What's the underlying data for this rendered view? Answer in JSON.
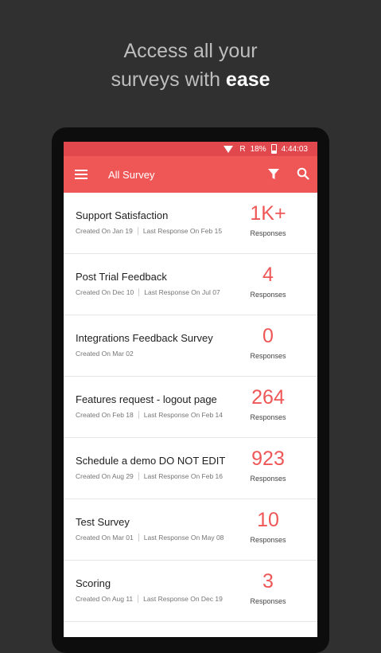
{
  "promo": {
    "line1": "Access all your",
    "line2_prefix": "surveys with ",
    "line2_bold": "ease"
  },
  "status_bar": {
    "network": "R",
    "battery": "18%",
    "time": "4:44:03"
  },
  "toolbar": {
    "title": "All Survey"
  },
  "surveys": [
    {
      "title": "Support Satisfaction",
      "created": "Created On Jan 19",
      "last_response": "Last Response On Feb 15",
      "count": "1K+",
      "count_label": "Responses"
    },
    {
      "title": "Post Trial Feedback",
      "created": "Created On Dec 10",
      "last_response": "Last Response On Jul 07",
      "count": "4",
      "count_label": "Responses"
    },
    {
      "title": "Integrations Feedback Survey",
      "created": "Created On Mar 02",
      "last_response": "",
      "count": "0",
      "count_label": "Responses"
    },
    {
      "title": "Features request - logout page",
      "created": "Created On Feb 18",
      "last_response": "Last Response On Feb 14",
      "count": "264",
      "count_label": "Responses"
    },
    {
      "title": "Schedule a demo DO NOT EDIT",
      "created": "Created On Aug 29",
      "last_response": "Last Response On Feb 16",
      "count": "923",
      "count_label": "Responses"
    },
    {
      "title": "Test Survey",
      "created": "Created On Mar 01",
      "last_response": "Last Response On May 08",
      "count": "10",
      "count_label": "Responses"
    },
    {
      "title": "Scoring",
      "created": "Created On Aug 11",
      "last_response": "Last Response On Dec 19",
      "count": "3",
      "count_label": "Responses"
    }
  ],
  "colors": {
    "accent": "#ef5757",
    "status_bar": "#e0484d",
    "background": "#303030"
  }
}
